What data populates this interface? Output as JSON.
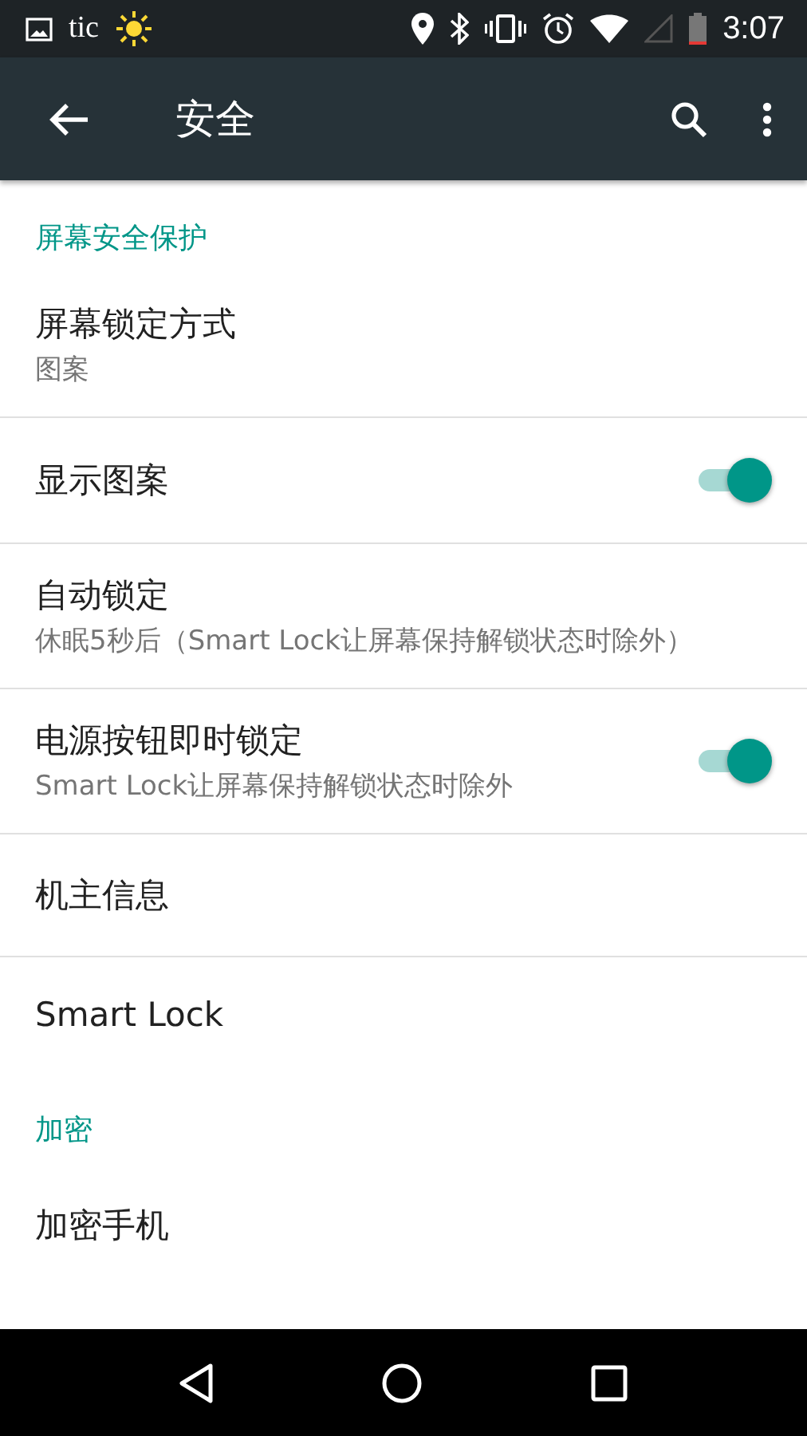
{
  "status_bar": {
    "app_label": "tic",
    "time": "3:07"
  },
  "toolbar": {
    "title": "安全"
  },
  "sections": [
    {
      "header": "屏幕安全保护",
      "items": [
        {
          "kind": "text",
          "title": "屏幕锁定方式",
          "summary": "图案"
        },
        {
          "kind": "switch",
          "title": "显示图案",
          "on": true
        },
        {
          "kind": "text",
          "title": "自动锁定",
          "summary": "休眠5秒后（Smart Lock让屏幕保持解锁状态时除外）"
        },
        {
          "kind": "switch",
          "title": "电源按钮即时锁定",
          "summary": "Smart Lock让屏幕保持解锁状态时除外",
          "on": true
        },
        {
          "kind": "text",
          "title": "机主信息"
        },
        {
          "kind": "text",
          "title": "Smart Lock"
        }
      ]
    },
    {
      "header": "加密",
      "items": [
        {
          "kind": "text",
          "title": "加密手机"
        }
      ]
    }
  ]
}
